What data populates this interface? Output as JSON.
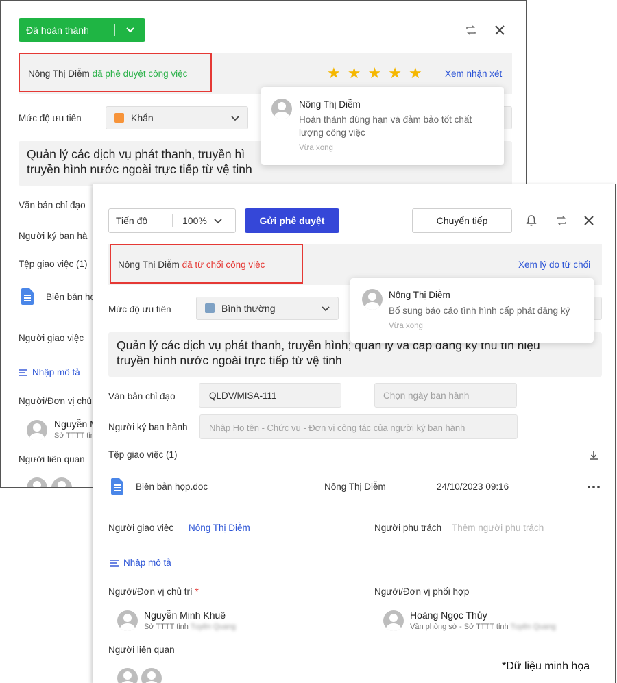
{
  "back_panel": {
    "status_label": "Đã hoàn thành",
    "approver_name": "Nông Thị Diễm",
    "approval_text": "đã phê duyệt công việc",
    "rating_stars": 5,
    "view_review": "Xem nhận xét",
    "priority_label": "Mức độ ưu tiên",
    "priority_value": "Khẩn",
    "priority_color": "#f7943a",
    "title_line1": "Quản lý các dịch vụ phát thanh, truyền hì",
    "title_line2": "truyền hình nước ngoài trực tiếp từ vệ tinh",
    "directive_label": "Văn bản chỉ đạo",
    "signer_label": "Người ký ban hà",
    "files_label": "Tệp giao việc (1)",
    "file_name": "Biên bản họ",
    "assigner_label": "Người giao việc",
    "desc_label": "Nhập mô tả",
    "lead_label": "Người/Đơn vị chủ",
    "lead_name": "Nguyễn M",
    "lead_sub": "Sở TTTT tỉnh",
    "related_label": "Người liên quan",
    "comment": {
      "name": "Nông Thị Diễm",
      "text_line1": "Hoàn thành đúng hạn và đảm bảo tốt chất",
      "text_line2": "lượng công việc",
      "time": "Vừa xong"
    }
  },
  "front_panel": {
    "progress_label": "Tiến độ",
    "progress_value": "100%",
    "submit_button": "Gửi phê duyệt",
    "forward_button": "Chuyển tiếp",
    "reviewer_name": "Nông Thị Diễm",
    "reject_text": "đã từ chối công việc",
    "view_reason": "Xem lý do từ chối",
    "priority_label": "Mức độ ưu tiên",
    "priority_value": "Bình thường",
    "priority_color": "#7ea1c4",
    "title_line1": "Quản lý các dịch vụ phát thanh, truyền hình; quản lý và cấp đăng ký thu tín hiệu",
    "title_line2": "truyền hình nước ngoài trực tiếp từ vệ tinh",
    "directive_label": "Văn bản chỉ đạo",
    "directive_value": "QLDV/MISA-111",
    "date_placeholder": "Chọn ngày ban hành",
    "signer_label": "Người ký ban hành",
    "signer_placeholder": "Nhập Họ tên - Chức vụ - Đơn vị công tác của người ký ban hành",
    "files_label": "Tệp giao việc (1)",
    "file": {
      "name": "Biên bản họp.doc",
      "owner": "Nông Thị Diễm",
      "date": "24/10/2023 09:16"
    },
    "assigner_label": "Người giao việc",
    "assigner_value": "Nông Thị Diễm",
    "owner_label": "Người phụ trách",
    "owner_placeholder": "Thêm người phụ trách",
    "desc_label": "Nhập mô tả",
    "lead_label": "Người/Đơn vị chủ trì",
    "required_mark": "*",
    "lead": {
      "name": "Nguyễn Minh Khuê",
      "sub": "Sở TTTT tỉnh",
      "sub_blur": "Tuyên Quang"
    },
    "coop_label": "Người/Đơn vị phối hợp",
    "coop": {
      "name": "Hoàng Ngọc Thủy",
      "sub": "Văn phòng sở - Sở TTTT tỉnh",
      "sub_blur": "Tuyên Quang"
    },
    "related_label": "Người liên quan",
    "reason": {
      "name": "Nông Thị Diễm",
      "text": "Bổ sung báo cáo tình hình cấp phát đăng ký",
      "time": "Vừa xong"
    }
  },
  "footnote": "*Dữ liệu minh họa"
}
